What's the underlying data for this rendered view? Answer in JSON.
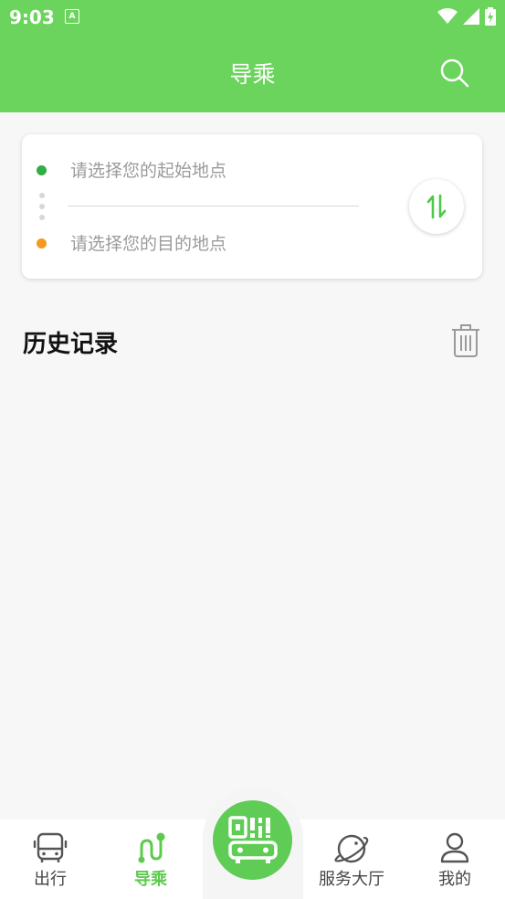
{
  "status_bar": {
    "time": "9:03",
    "notification_letter": "A"
  },
  "header": {
    "title": "导乘",
    "search_icon": "search-icon"
  },
  "route": {
    "start_placeholder": "请选择您的起始地点",
    "end_placeholder": "请选择您的目的地点",
    "swap_icon": "swap-vertical-icon"
  },
  "history": {
    "title": "历史记录",
    "clear_icon": "trash-icon"
  },
  "tabbar": {
    "items": [
      {
        "label": "出行",
        "icon": "bus-icon",
        "active": false
      },
      {
        "label": "导乘",
        "icon": "route-icon",
        "active": true
      },
      {
        "label": "",
        "icon": "qr-bus-icon",
        "active": false
      },
      {
        "label": "服务大厅",
        "icon": "planet-icon",
        "active": false
      },
      {
        "label": "我的",
        "icon": "user-icon",
        "active": false
      }
    ]
  },
  "colors": {
    "brand": "#6bd45c",
    "start_dot": "#2fae43",
    "end_dot": "#f39a1f",
    "active_tab": "#5ccb4c"
  }
}
